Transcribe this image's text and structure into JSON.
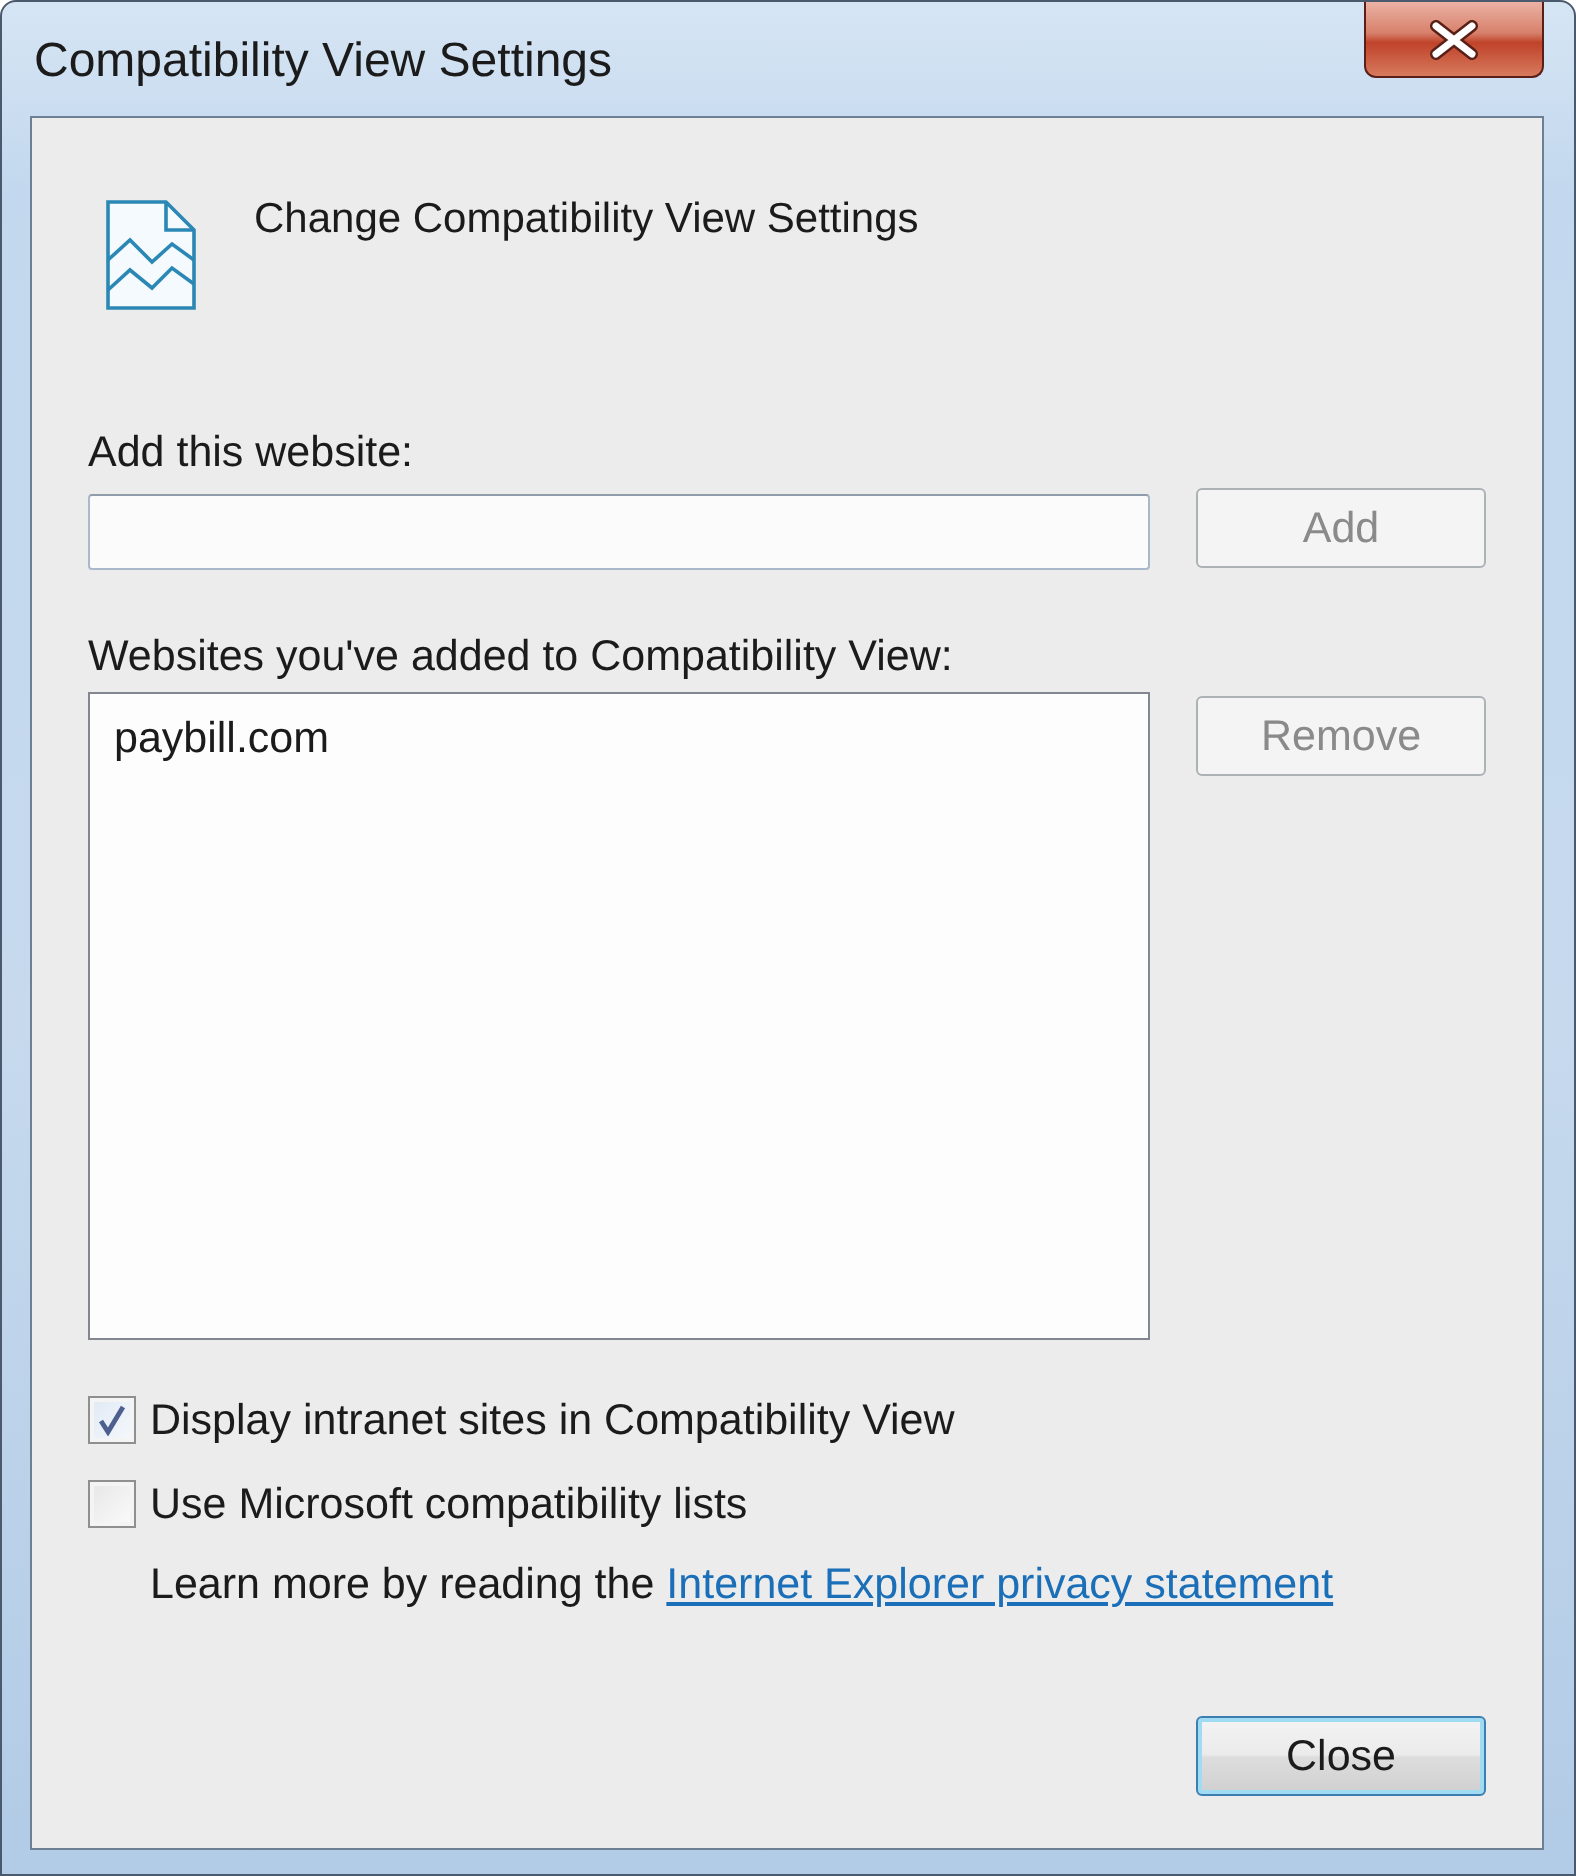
{
  "window": {
    "title": "Compatibility View Settings"
  },
  "header": {
    "title": "Change Compatibility View Settings"
  },
  "add_website": {
    "label": "Add this website:",
    "button": {
      "label": "Add",
      "disabled": true
    }
  },
  "websites": {
    "label": "Websites you've added to Compatibility View:",
    "items": [
      {
        "text": "paybill.com",
        "selected": false
      }
    ],
    "remove_button": {
      "label": "Remove",
      "disabled": true
    }
  },
  "options": [
    {
      "label": "Display intranet sites in Compatibility View",
      "checked": true
    },
    {
      "label": "Use Microsoft compatibility lists",
      "checked": false
    }
  ],
  "privacy_note": {
    "text": "Learn more by reading the",
    "link": "Internet Explorer privacy statement"
  },
  "close_button": {
    "label": "Close",
    "default": true
  }
}
